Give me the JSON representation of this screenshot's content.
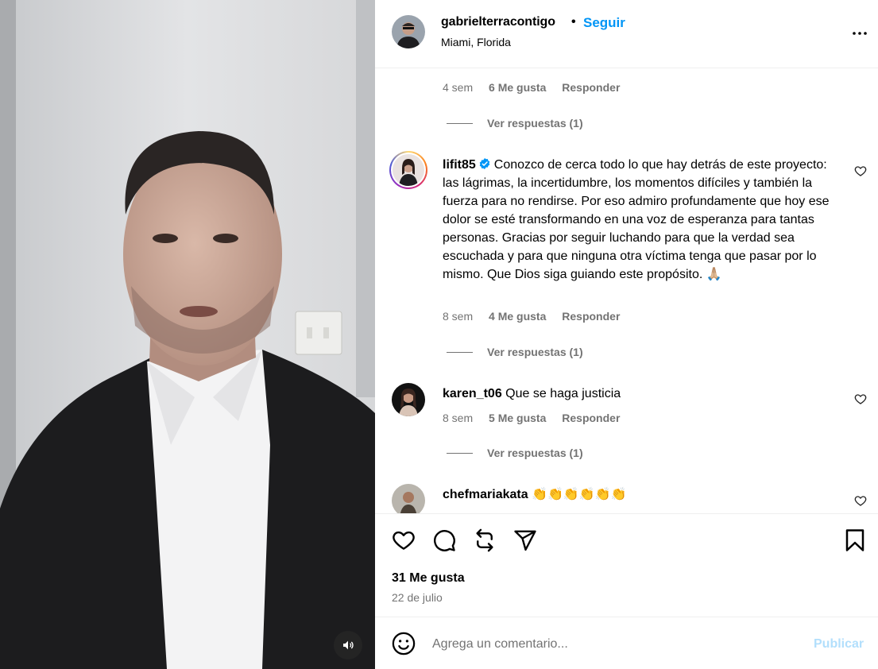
{
  "post": {
    "username": "gabrielterracontigo",
    "separator": "•",
    "follow_label": "Seguir",
    "location": "Miami, Florida",
    "likes": "31 Me gusta",
    "date": "22 de julio"
  },
  "comments": [
    {
      "time": "4 sem",
      "likes": "6 Me gusta",
      "reply": "Responder",
      "view_replies": "Ver respuestas (1)"
    },
    {
      "username": "lifit85",
      "verified": true,
      "text": "Conozco de cerca todo lo que hay detrás de este proyecto: las lágrimas, la incertidumbre, los momentos difíciles y también la fuerza para no rendirse. Por eso admiro profundamente que hoy ese dolor se esté transformando en una voz de esperanza para tantas personas. Gracias por seguir luchando para que la verdad sea escuchada y para que ninguna otra víctima tenga que pasar por lo mismo. Que Dios siga guiando este propósito. 🙏🏼",
      "time": "8 sem",
      "likes": "4 Me gusta",
      "reply": "Responder",
      "view_replies": "Ver respuestas (1)"
    },
    {
      "username": "karen_t06",
      "text": "Que se haga justicia",
      "time": "8 sem",
      "likes": "5 Me gusta",
      "reply": "Responder",
      "view_replies": "Ver respuestas (1)"
    },
    {
      "username": "chefmariakata",
      "text": "👏👏👏👏👏👏"
    }
  ],
  "composer": {
    "placeholder": "Agrega un comentario...",
    "publish_label": "Publicar"
  },
  "icons": {
    "more": "more-options-icon",
    "like": "heart-icon",
    "comment": "comment-icon",
    "repost": "repost-icon",
    "share": "share-icon",
    "save": "bookmark-icon",
    "emoji": "emoji-icon",
    "mute": "speaker-icon",
    "verified": "verified-badge-icon"
  },
  "colors": {
    "accent": "#0095f6",
    "accent_disabled": "#b2dffc",
    "secondary_text": "#737373",
    "divider": "#efefef"
  }
}
